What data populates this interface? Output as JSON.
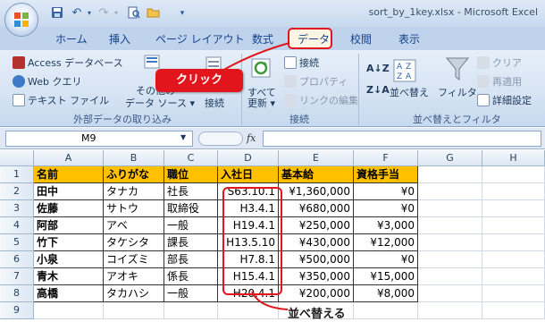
{
  "window": {
    "title": "sort_by_1key.xlsx - Microsoft Excel"
  },
  "qat": {
    "icons": [
      "save-icon",
      "undo-icon",
      "redo-icon",
      "print-preview-icon",
      "open-folder-icon"
    ]
  },
  "tabs": [
    {
      "label": "ホーム"
    },
    {
      "label": "挿入"
    },
    {
      "label": "ページ レイアウト"
    },
    {
      "label": "数式"
    },
    {
      "label": "データ"
    },
    {
      "label": "校閲"
    },
    {
      "label": "表示"
    }
  ],
  "ribbon": {
    "external": {
      "access": "Access データベース",
      "web": "Web クエリ",
      "text": "テキスト ファイル",
      "other_line1": "その他の",
      "other_line2": "データ ソース ▾",
      "existing": "接続",
      "group": "外部データの取り込み"
    },
    "connections": {
      "refresh_line1": "すべて",
      "refresh_line2": "更新 ▾",
      "connect": "接続",
      "properties": "プロパティ",
      "edit_links": "リンクの編集",
      "group": "接続"
    },
    "sort": {
      "sort_label": "並べ替え",
      "filter": "フィルタ",
      "clear": "クリア",
      "reapply": "再適用",
      "advanced": "詳細設定",
      "group": "並べ替えとフィルタ"
    }
  },
  "callout": {
    "click_label": "クリック",
    "sort_note": "並べ替える"
  },
  "formula_bar": {
    "name_box": "M9",
    "fx": "fx",
    "formula": ""
  },
  "sheet": {
    "columns": [
      "A",
      "B",
      "C",
      "D",
      "E",
      "F",
      "G",
      "H"
    ],
    "rows": [
      "1",
      "2",
      "3",
      "4",
      "5",
      "6",
      "7",
      "8",
      "9"
    ],
    "header": [
      "名前",
      "ふりがな",
      "職位",
      "入社日",
      "基本給",
      "資格手当"
    ],
    "data": [
      [
        "田中",
        "タナカ",
        "社長",
        "S63.10.1",
        "¥1,360,000",
        "¥0"
      ],
      [
        "佐藤",
        "サトウ",
        "取締役",
        "H3.4.1",
        "¥680,000",
        "¥0"
      ],
      [
        "阿部",
        "アベ",
        "一般",
        "H19.4.1",
        "¥250,000",
        "¥3,000"
      ],
      [
        "竹下",
        "タケシタ",
        "課長",
        "H13.5.10",
        "¥430,000",
        "¥12,000"
      ],
      [
        "小泉",
        "コイズミ",
        "部長",
        "H7.8.1",
        "¥500,000",
        "¥0"
      ],
      [
        "青木",
        "アオキ",
        "係長",
        "H15.4.1",
        "¥350,000",
        "¥15,000"
      ],
      [
        "高橋",
        "タカハシ",
        "一般",
        "H20.4.1",
        "¥200,000",
        "¥8,000"
      ]
    ]
  },
  "colors": {
    "header_fill": "#ffc000",
    "annotation_red": "#e2151c"
  }
}
